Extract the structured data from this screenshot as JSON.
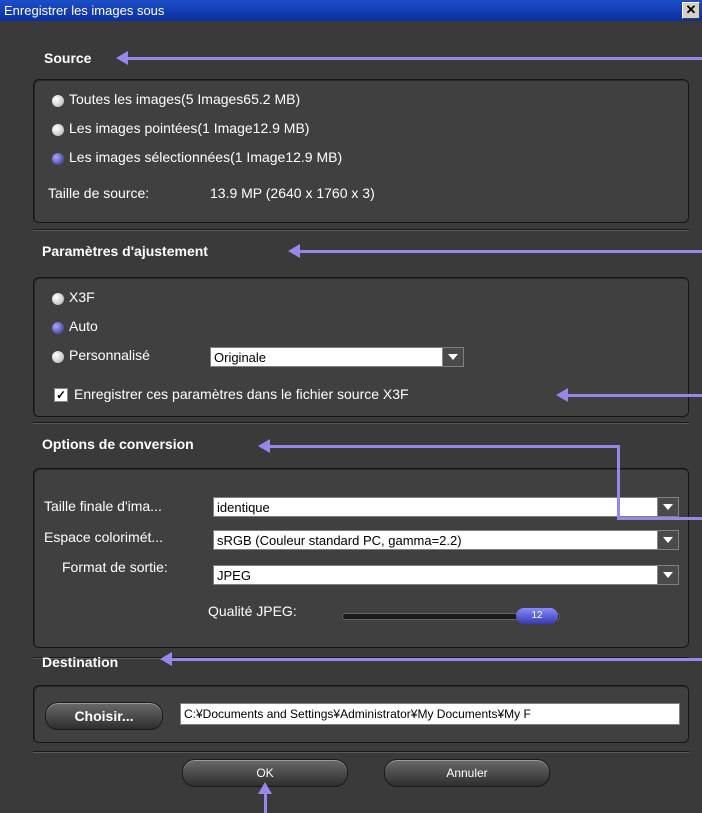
{
  "window": {
    "title": "Enregistrer les images sous",
    "close_glyph": "✕"
  },
  "source": {
    "title": "Source",
    "options": [
      {
        "label": "Toutes les images(5 Images65.2 MB)",
        "selected": false
      },
      {
        "label": "Les images pointées(1 Image12.9 MB)",
        "selected": false
      },
      {
        "label": "Les images sélectionnées(1 Image12.9 MB)",
        "selected": true
      }
    ],
    "size_label": "Taille de source:",
    "size_value": "13.9 MP (2640 x 1760 x 3)"
  },
  "adjust": {
    "title": "Paramètres d'ajustement",
    "options": [
      {
        "label": "X3F",
        "selected": false
      },
      {
        "label": "Auto",
        "selected": true
      },
      {
        "label": "Personnalisé",
        "selected": false
      }
    ],
    "custom_select": "Originale",
    "save_checkbox_label": "Enregistrer ces paramètres dans le fichier source X3F",
    "save_checked": true
  },
  "conversion": {
    "title": "Options de conversion",
    "size_label": "Taille finale d'ima...",
    "size_value": "identique",
    "colorspace_label": "Espace colorimét...",
    "colorspace_value": "sRGB (Couleur standard PC, gamma=2.2)",
    "format_label": "Format de sortie:",
    "format_value": "JPEG",
    "quality_label": "Qualité JPEG:",
    "quality_value": "12"
  },
  "destination": {
    "title": "Destination",
    "choose_label": "Choisir...",
    "path": "C:¥Documents and Settings¥Administrator¥My Documents¥My F"
  },
  "footer": {
    "ok_label": "OK",
    "cancel_label": "Annuler"
  },
  "colors": {
    "annotation_arrow": "#9a86e8",
    "selected_radio": "#5a5ab0",
    "title_bar": "#0a2fa0"
  }
}
